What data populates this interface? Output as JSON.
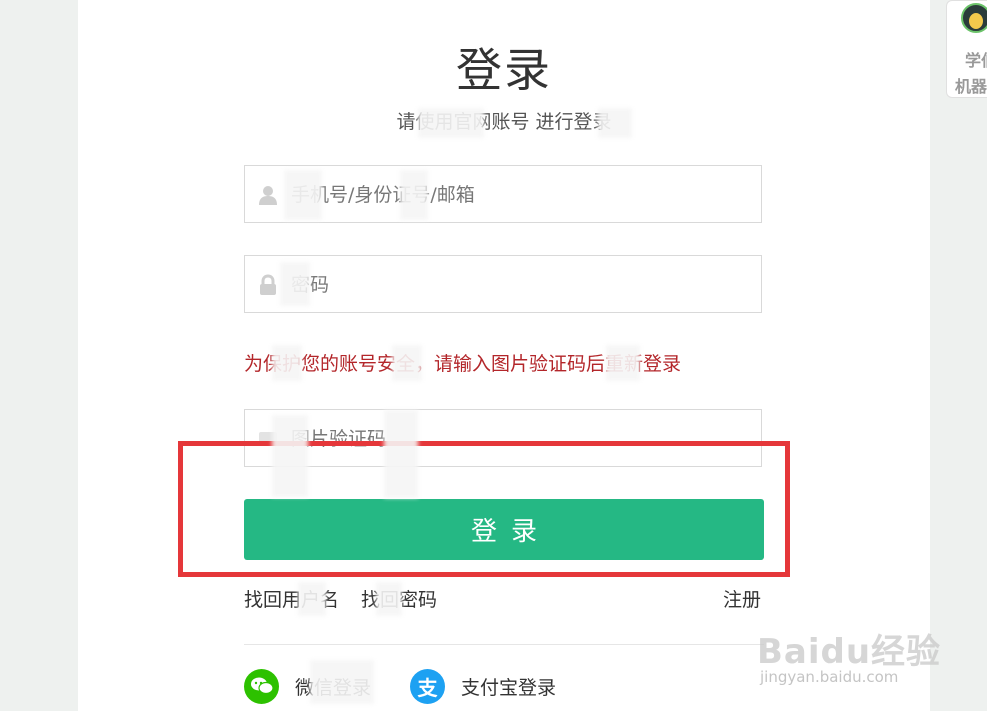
{
  "header": {
    "title": "登录",
    "subtitle": "请使用官网账号 进行登录"
  },
  "form": {
    "account_placeholder": "手机号/身份证号/邮箱",
    "password_placeholder": "密码",
    "captcha_notice": "为保护您的账号安全，请输入图片验证码后重新登录",
    "captcha_placeholder": "图片验证码",
    "login_label": "登录"
  },
  "links": {
    "find_username": "找回用户名",
    "find_password": "找回密码",
    "register": "注册"
  },
  "social": {
    "wechat_label": "微信登录",
    "alipay_label": "支付宝登录"
  },
  "side_widget": {
    "line1": "学伯",
    "line2": "机器"
  },
  "watermark": {
    "logo": "Baidu经验",
    "url": "jingyan.baidu.com"
  },
  "colors": {
    "primary_green": "#25b884",
    "error_red": "#b3262a",
    "highlight_red": "#e5373a",
    "wechat_green": "#2dc100",
    "alipay_blue": "#1da1f2"
  }
}
